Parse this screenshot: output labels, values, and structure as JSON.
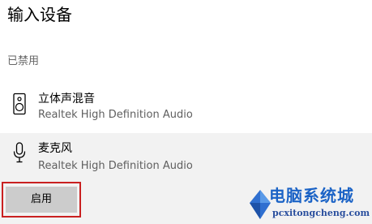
{
  "page": {
    "title": "输入设备",
    "section_label": "已禁用"
  },
  "devices": [
    {
      "name": "立体声混音",
      "subtitle": "Realtek High Definition Audio",
      "icon": "speaker-icon"
    },
    {
      "name": "麦克风",
      "subtitle": "Realtek High Definition Audio",
      "icon": "microphone-icon"
    }
  ],
  "actions": {
    "enable_label": "启用"
  },
  "watermark": {
    "title": "电脑系统城",
    "url": "pcxitongcheng.com"
  },
  "colors": {
    "selected_row_bg": "#f2f2f2",
    "button_bg": "#cccccc",
    "highlight_border": "#c92020",
    "watermark_blue": "#1b63c6"
  }
}
